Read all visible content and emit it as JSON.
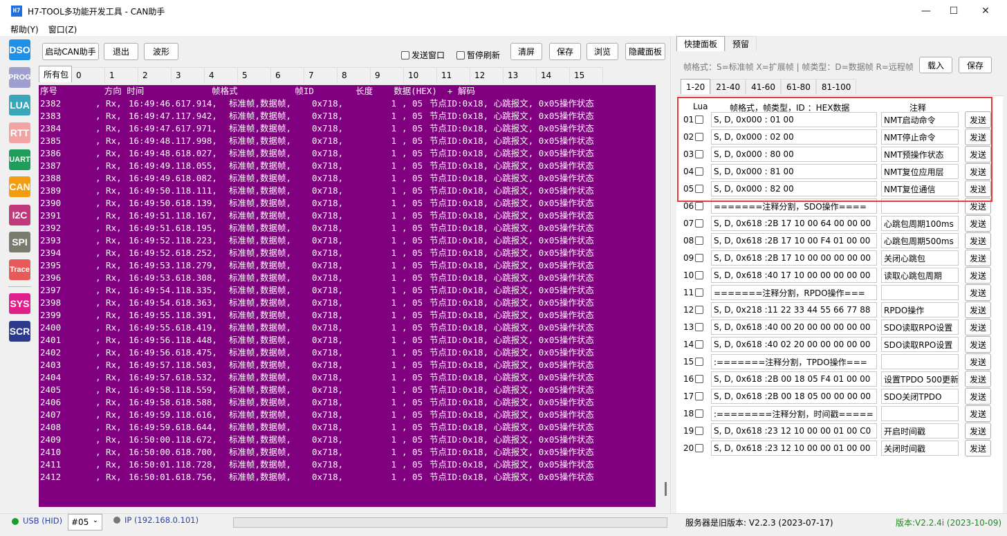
{
  "window": {
    "title": "H7-TOOL多功能开发工具 - CAN助手",
    "icon_text": "H7",
    "minimize": "—",
    "maximize": "☐",
    "close": "✕"
  },
  "menu": [
    "帮助(Y)",
    "窗口(Z)"
  ],
  "sidebar": [
    {
      "label": "DSO",
      "color": "#1e90e8"
    },
    {
      "label": "PROG",
      "color": "#9e9ecf"
    },
    {
      "label": "LUA",
      "color": "#3aa6b9"
    },
    {
      "label": "RTT",
      "color": "#f4a3a3"
    },
    {
      "label": "UART",
      "color": "#1f9d5a"
    },
    {
      "label": "CAN",
      "color": "#f39c12"
    },
    {
      "label": "I2C",
      "color": "#c0397a"
    },
    {
      "label": "SPI",
      "color": "#7a7a6e"
    },
    {
      "label": "Trace",
      "color": "#e85a5a"
    },
    {
      "label": "SYS",
      "color": "#e01f8a"
    },
    {
      "label": "SCR",
      "color": "#2b3a8c"
    }
  ],
  "toolbar": {
    "start": "启动CAN助手",
    "exit": "退出",
    "wave": "波形",
    "send_window": "发送窗口",
    "pause_refresh": "暂停刷新",
    "clear": "清屏",
    "save": "保存",
    "browse": "浏览",
    "hide_panel": "隐藏面板"
  },
  "packet_tabs": [
    "所有包",
    "0",
    "1",
    "2",
    "3",
    "4",
    "5",
    "6",
    "7",
    "8",
    "9",
    "10",
    "11",
    "12",
    "13",
    "14",
    "15"
  ],
  "log": {
    "header": "序号         方向 时间             帧格式           帧ID        长度    数据(HEX)  + 解码",
    "rows": [
      [
        "2382",
        ", Rx,",
        "16:49:46.617.914,",
        "标准帧,数据帧,",
        "0x718,",
        "1",
        ", 05",
        "节点ID:0x18, 心跳报文, 0x05操作状态"
      ],
      [
        "2383",
        ", Rx,",
        "16:49:47.117.942,",
        "标准帧,数据帧,",
        "0x718,",
        "1",
        ", 05",
        "节点ID:0x18, 心跳报文, 0x05操作状态"
      ],
      [
        "2384",
        ", Rx,",
        "16:49:47.617.971,",
        "标准帧,数据帧,",
        "0x718,",
        "1",
        ", 05",
        "节点ID:0x18, 心跳报文, 0x05操作状态"
      ],
      [
        "2385",
        ", Rx,",
        "16:49:48.117.998,",
        "标准帧,数据帧,",
        "0x718,",
        "1",
        ", 05",
        "节点ID:0x18, 心跳报文, 0x05操作状态"
      ],
      [
        "2386",
        ", Rx,",
        "16:49:48.618.027,",
        "标准帧,数据帧,",
        "0x718,",
        "1",
        ", 05",
        "节点ID:0x18, 心跳报文, 0x05操作状态"
      ],
      [
        "2387",
        ", Rx,",
        "16:49:49.118.055,",
        "标准帧,数据帧,",
        "0x718,",
        "1",
        ", 05",
        "节点ID:0x18, 心跳报文, 0x05操作状态"
      ],
      [
        "2388",
        ", Rx,",
        "16:49:49.618.082,",
        "标准帧,数据帧,",
        "0x718,",
        "1",
        ", 05",
        "节点ID:0x18, 心跳报文, 0x05操作状态"
      ],
      [
        "2389",
        ", Rx,",
        "16:49:50.118.111,",
        "标准帧,数据帧,",
        "0x718,",
        "1",
        ", 05",
        "节点ID:0x18, 心跳报文, 0x05操作状态"
      ],
      [
        "2390",
        ", Rx,",
        "16:49:50.618.139,",
        "标准帧,数据帧,",
        "0x718,",
        "1",
        ", 05",
        "节点ID:0x18, 心跳报文, 0x05操作状态"
      ],
      [
        "2391",
        ", Rx,",
        "16:49:51.118.167,",
        "标准帧,数据帧,",
        "0x718,",
        "1",
        ", 05",
        "节点ID:0x18, 心跳报文, 0x05操作状态"
      ],
      [
        "2392",
        ", Rx,",
        "16:49:51.618.195,",
        "标准帧,数据帧,",
        "0x718,",
        "1",
        ", 05",
        "节点ID:0x18, 心跳报文, 0x05操作状态"
      ],
      [
        "2393",
        ", Rx,",
        "16:49:52.118.223,",
        "标准帧,数据帧,",
        "0x718,",
        "1",
        ", 05",
        "节点ID:0x18, 心跳报文, 0x05操作状态"
      ],
      [
        "2394",
        ", Rx,",
        "16:49:52.618.252,",
        "标准帧,数据帧,",
        "0x718,",
        "1",
        ", 05",
        "节点ID:0x18, 心跳报文, 0x05操作状态"
      ],
      [
        "2395",
        ", Rx,",
        "16:49:53.118.279,",
        "标准帧,数据帧,",
        "0x718,",
        "1",
        ", 05",
        "节点ID:0x18, 心跳报文, 0x05操作状态"
      ],
      [
        "2396",
        ", Rx,",
        "16:49:53.618.308,",
        "标准帧,数据帧,",
        "0x718,",
        "1",
        ", 05",
        "节点ID:0x18, 心跳报文, 0x05操作状态"
      ],
      [
        "2397",
        ", Rx,",
        "16:49:54.118.335,",
        "标准帧,数据帧,",
        "0x718,",
        "1",
        ", 05",
        "节点ID:0x18, 心跳报文, 0x05操作状态"
      ],
      [
        "2398",
        ", Rx,",
        "16:49:54.618.363,",
        "标准帧,数据帧,",
        "0x718,",
        "1",
        ", 05",
        "节点ID:0x18, 心跳报文, 0x05操作状态"
      ],
      [
        "2399",
        ", Rx,",
        "16:49:55.118.391,",
        "标准帧,数据帧,",
        "0x718,",
        "1",
        ", 05",
        "节点ID:0x18, 心跳报文, 0x05操作状态"
      ],
      [
        "2400",
        ", Rx,",
        "16:49:55.618.419,",
        "标准帧,数据帧,",
        "0x718,",
        "1",
        ", 05",
        "节点ID:0x18, 心跳报文, 0x05操作状态"
      ],
      [
        "2401",
        ", Rx,",
        "16:49:56.118.448,",
        "标准帧,数据帧,",
        "0x718,",
        "1",
        ", 05",
        "节点ID:0x18, 心跳报文, 0x05操作状态"
      ],
      [
        "2402",
        ", Rx,",
        "16:49:56.618.475,",
        "标准帧,数据帧,",
        "0x718,",
        "1",
        ", 05",
        "节点ID:0x18, 心跳报文, 0x05操作状态"
      ],
      [
        "2403",
        ", Rx,",
        "16:49:57.118.503,",
        "标准帧,数据帧,",
        "0x718,",
        "1",
        ", 05",
        "节点ID:0x18, 心跳报文, 0x05操作状态"
      ],
      [
        "2404",
        ", Rx,",
        "16:49:57.618.532,",
        "标准帧,数据帧,",
        "0x718,",
        "1",
        ", 05",
        "节点ID:0x18, 心跳报文, 0x05操作状态"
      ],
      [
        "2405",
        ", Rx,",
        "16:49:58.118.559,",
        "标准帧,数据帧,",
        "0x718,",
        "1",
        ", 05",
        "节点ID:0x18, 心跳报文, 0x05操作状态"
      ],
      [
        "2406",
        ", Rx,",
        "16:49:58.618.588,",
        "标准帧,数据帧,",
        "0x718,",
        "1",
        ", 05",
        "节点ID:0x18, 心跳报文, 0x05操作状态"
      ],
      [
        "2407",
        ", Rx,",
        "16:49:59.118.616,",
        "标准帧,数据帧,",
        "0x718,",
        "1",
        ", 05",
        "节点ID:0x18, 心跳报文, 0x05操作状态"
      ],
      [
        "2408",
        ", Rx,",
        "16:49:59.618.644,",
        "标准帧,数据帧,",
        "0x718,",
        "1",
        ", 05",
        "节点ID:0x18, 心跳报文, 0x05操作状态"
      ],
      [
        "2409",
        ", Rx,",
        "16:50:00.118.672,",
        "标准帧,数据帧,",
        "0x718,",
        "1",
        ", 05",
        "节点ID:0x18, 心跳报文, 0x05操作状态"
      ],
      [
        "2410",
        ", Rx,",
        "16:50:00.618.700,",
        "标准帧,数据帧,",
        "0x718,",
        "1",
        ", 05",
        "节点ID:0x18, 心跳报文, 0x05操作状态"
      ],
      [
        "2411",
        ", Rx,",
        "16:50:01.118.728,",
        "标准帧,数据帧,",
        "0x718,",
        "1",
        ", 05",
        "节点ID:0x18, 心跳报文, 0x05操作状态"
      ],
      [
        "2412",
        ", Rx,",
        "16:50:01.618.756,",
        "标准帧,数据帧,",
        "0x718,",
        "1",
        ", 05",
        "节点ID:0x18, 心跳报文, 0x05操作状态"
      ]
    ]
  },
  "right_panel": {
    "tabs": [
      "快捷面板",
      "预留"
    ],
    "legend": "帧格式：S=标准帧 X=扩展帧 | 帧类型：D=数据帧 R=远程帧",
    "load": "载入",
    "save": "保存",
    "range_tabs": [
      "1-20",
      "21-40",
      "41-60",
      "61-80",
      "81-100"
    ],
    "col_lua": "Lua",
    "col_frame": "帧格式，帧类型，ID ：HEX数据",
    "col_note": "注释",
    "send_label": "发送",
    "rows": [
      {
        "num": "01",
        "frame": "S, D, 0x000 : 01 00",
        "note": "NMT启动命令"
      },
      {
        "num": "02",
        "frame": "S, D, 0x000 : 02 00",
        "note": "NMT停止命令"
      },
      {
        "num": "03",
        "frame": "S, D, 0x000 : 80 00",
        "note": "NMT预操作状态"
      },
      {
        "num": "04",
        "frame": "S, D, 0x000 : 81 00",
        "note": "NMT复位应用层"
      },
      {
        "num": "05",
        "frame": "S, D, 0x000 : 82 00",
        "note": "NMT复位通信"
      },
      {
        "num": "06",
        "frame": "=======注释分割，SDO操作====",
        "note": ""
      },
      {
        "num": "07",
        "frame": "S, D, 0x618 :2B 17 10 00 64 00 00 00",
        "note": "心跳包周期100ms"
      },
      {
        "num": "08",
        "frame": "S, D, 0x618 :2B 17 10 00 F4 01 00 00",
        "note": "心跳包周期500ms"
      },
      {
        "num": "09",
        "frame": "S, D, 0x618 :2B 17 10 00 00 00 00 00",
        "note": "关闭心跳包"
      },
      {
        "num": "10",
        "frame": "S, D, 0x618 :40 17 10 00 00 00 00 00",
        "note": "读取心跳包周期"
      },
      {
        "num": "11",
        "frame": "=======注释分割，RPDO操作===",
        "note": ""
      },
      {
        "num": "12",
        "frame": "S, D, 0x218 :11 22 33 44 55 66 77 88",
        "note": "RPDO操作"
      },
      {
        "num": "13",
        "frame": "S, D, 0x618 :40 00 20 00 00 00 00 00",
        "note": "SDO读取RPO设置"
      },
      {
        "num": "14",
        "frame": "S, D, 0x618 :40 02 20 00 00 00 00 00",
        "note": "SDO读取RPO设置"
      },
      {
        "num": "15",
        "frame": ":=======注释分割，TPDO操作===",
        "note": ""
      },
      {
        "num": "16",
        "frame": "S, D, 0x618 :2B 00 18 05 F4 01 00 00",
        "note": "设置TPDO 500更新"
      },
      {
        "num": "17",
        "frame": "S, D, 0x618 :2B 00 18 05 00 00 00 00",
        "note": "SDO关闭TPDO"
      },
      {
        "num": "18",
        "frame": ":========注释分割，时间戳=====",
        "note": ""
      },
      {
        "num": "19",
        "frame": "S, D, 0x618 :23 12 10 00 00 01 00 C0",
        "note": "开启时间戳"
      },
      {
        "num": "20",
        "frame": "S, D, 0x618 :23 12 10 00 00 01 00 00",
        "note": "关闭时间戳"
      }
    ]
  },
  "status": {
    "usb": "USB (HID)",
    "port": "#05",
    "ip": "IP (192.168.0.101)",
    "server": "服务器是旧版本: V2.2.3 (2023-07-17)",
    "version": "版本:V2.2.4i (2023-10-09)",
    "usb_dot_color": "#1a9e2a",
    "ip_dot_color": "#777777",
    "version_color": "#1f8a1f"
  }
}
